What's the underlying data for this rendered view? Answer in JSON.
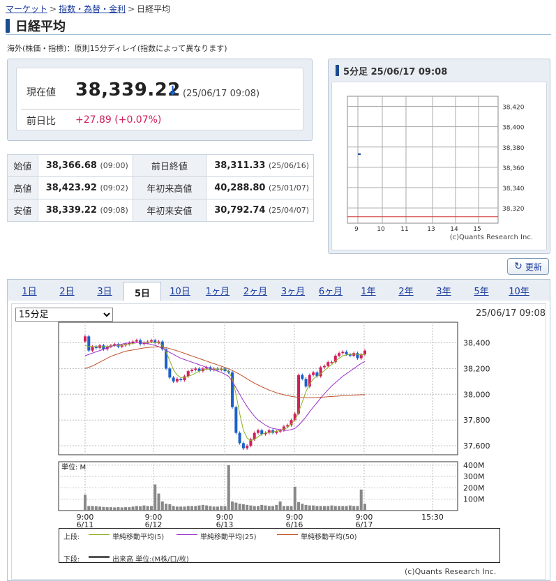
{
  "breadcrumb": {
    "items": [
      "マーケット",
      "指数・為替・金利"
    ],
    "current": "日経平均",
    "sep": ">"
  },
  "page_title": "日経平均",
  "note": "海外(株価・指標)：原則15分ディレイ(指数によって異なります)",
  "quote": {
    "label": "現在値",
    "value": "38,339.22",
    "arrow": "↓",
    "time": "(25/06/17 09:08)",
    "change_label": "前日比",
    "change": "+27.89 (+0.07%)"
  },
  "stats": [
    {
      "l1": "始値",
      "v1": "38,366.68",
      "t1": "(09:00)",
      "l2": "前日終値",
      "v2": "38,311.33",
      "t2": "(25/06/16)"
    },
    {
      "l1": "高値",
      "v1": "38,423.92",
      "t1": "(09:02)",
      "l2": "年初来高値",
      "v2": "40,288.80",
      "t2": "(25/01/07)"
    },
    {
      "l1": "安値",
      "v1": "38,339.22",
      "t1": "(09:08)",
      "l2": "年初来安値",
      "v2": "30,792.74",
      "t2": "(25/04/07)"
    }
  ],
  "mini": {
    "title": "5分足  25/06/17 09:08",
    "copyright": "(c)Quants Research Inc."
  },
  "refresh_label": "更新",
  "tabs": [
    "1日",
    "2日",
    "3日",
    "5日",
    "10日",
    "1ヶ月",
    "2ヶ月",
    "3ヶ月",
    "6ヶ月",
    "1年",
    "2年",
    "3年",
    "5年",
    "10年"
  ],
  "active_tab": "5日",
  "interval_select": {
    "value": "15分足",
    "options": [
      "15分足"
    ]
  },
  "chart_time": "25/06/17 09:08",
  "legend": {
    "upper_label": "上段:",
    "lower_label": "下段:",
    "ma5": "単純移動平均(5)",
    "ma25": "単純移動平均(25)",
    "ma50": "単純移動平均(50)",
    "volume": "出来高 単位:(M株/口/枚)"
  },
  "copyright": "(c)Quants Research Inc.",
  "colors": {
    "up": "#d0205a",
    "down": "#1b5fcc",
    "ma5": "#8ab020",
    "ma25": "#9b2fc9",
    "ma50": "#c0502a",
    "volume": "#888888",
    "accent": "#1b4c8f"
  },
  "chart_data": [
    {
      "type": "line",
      "title": "5分足 25/06/17 09:08",
      "x_ticks": [
        "9",
        "10",
        "11",
        "13",
        "14",
        "15"
      ],
      "y_ticks": [
        38320,
        38340,
        38360,
        38380,
        38400,
        38420
      ],
      "ylim": [
        38305,
        38430
      ],
      "reference_line": 38311.33,
      "series": [
        {
          "x": [
            "9:00"
          ],
          "values": [
            38373
          ]
        }
      ]
    },
    {
      "type": "candlestick",
      "title": "15分足",
      "x_ticks": [
        {
          "time": "9:00",
          "date": "6/11"
        },
        {
          "time": "9:00",
          "date": "6/12"
        },
        {
          "time": "9:00",
          "date": "6/13"
        },
        {
          "time": "9:00",
          "date": "6/16"
        },
        {
          "time": "9:00",
          "date": "6/17"
        },
        {
          "time": "15:30",
          "date": ""
        }
      ],
      "y_ticks": [
        37600,
        37800,
        38000,
        38200,
        38400
      ],
      "ylim": [
        37530,
        38560
      ],
      "volume_ticks": [
        "100M",
        "200M",
        "300M",
        "400M"
      ],
      "volume_unit": "単位: M",
      "closes": [
        38450,
        38340,
        38370,
        38360,
        38380,
        38350,
        38370,
        38380,
        38390,
        38370,
        38380,
        38390,
        38400,
        38410,
        38420,
        38390,
        38400,
        38410,
        38420,
        38400,
        38410,
        38350,
        38200,
        38130,
        38100,
        38120,
        38110,
        38140,
        38180,
        38190,
        38200,
        38180,
        38200,
        38210,
        38190,
        38200,
        38190,
        38200,
        38180,
        38170,
        37900,
        37700,
        37620,
        37580,
        37600,
        37650,
        37700,
        37720,
        37690,
        37700,
        37720,
        37700,
        37710,
        37720,
        37750,
        37760,
        37800,
        37850,
        38150,
        38120,
        38060,
        38150,
        38170,
        38140,
        38210,
        38220,
        38250,
        38250,
        38300,
        38320,
        38330,
        38310,
        38300,
        38320,
        38280,
        38310,
        38339
      ],
      "ma5": [
        38380,
        38370,
        38370,
        38370,
        38370,
        38370,
        38370,
        38375,
        38380,
        38380,
        38380,
        38385,
        38390,
        38395,
        38400,
        38400,
        38400,
        38405,
        38405,
        38405,
        38400,
        38380,
        38330,
        38260,
        38190,
        38150,
        38130,
        38130,
        38140,
        38150,
        38165,
        38180,
        38190,
        38195,
        38196,
        38196,
        38196,
        38196,
        38192,
        38180,
        38120,
        38000,
        37850,
        37720,
        37660,
        37640,
        37650,
        37670,
        37690,
        37700,
        37705,
        37708,
        37712,
        37720,
        37730,
        37740,
        37770,
        37800,
        37860,
        37940,
        38020,
        38080,
        38120,
        38140,
        38160,
        38185,
        38210,
        38230,
        38260,
        38280,
        38300,
        38305,
        38310,
        38312,
        38310,
        38305,
        38310
      ],
      "ma25": [
        38300,
        38310,
        38320,
        38330,
        38340,
        38350,
        38360,
        38370,
        38380,
        38385,
        38390,
        38395,
        38400,
        38400,
        38400,
        38400,
        38398,
        38394,
        38388,
        38380,
        38370,
        38358,
        38340,
        38325,
        38310,
        38295,
        38280,
        38270,
        38260,
        38250,
        38240,
        38230,
        38220,
        38210,
        38200,
        38190,
        38180,
        38170,
        38155,
        38140,
        38100,
        38050,
        38000,
        37950,
        37905,
        37865,
        37830,
        37800,
        37780,
        37760,
        37745,
        37735,
        37730,
        37725,
        37720,
        37720,
        37725,
        37735,
        37760,
        37790,
        37825,
        37865,
        37900,
        37935,
        37970,
        38005,
        38035,
        38065,
        38090,
        38115,
        38140,
        38160,
        38180,
        38200,
        38220,
        38240,
        38255
      ],
      "ma50": [
        38200,
        38210,
        38220,
        38235,
        38250,
        38265,
        38280,
        38295,
        38305,
        38315,
        38325,
        38335,
        38340,
        38345,
        38350,
        38355,
        38360,
        38363,
        38366,
        38368,
        38368,
        38366,
        38362,
        38355,
        38347,
        38338,
        38328,
        38318,
        38308,
        38298,
        38288,
        38278,
        38268,
        38258,
        38248,
        38238,
        38228,
        38218,
        38208,
        38198,
        38185,
        38170,
        38155,
        38138,
        38120,
        38103,
        38087,
        38072,
        38058,
        38045,
        38033,
        38022,
        38012,
        38004,
        37996,
        37990,
        37984,
        37980,
        37976,
        37974,
        37973,
        37973,
        37974,
        37975,
        37977,
        37979,
        37981,
        37983,
        37985,
        37987,
        37989,
        37991,
        37993,
        37994,
        37995,
        37996,
        37998
      ],
      "volume": [
        140,
        40,
        40,
        38,
        35,
        32,
        30,
        30,
        28,
        30,
        28,
        30,
        30,
        35,
        40,
        38,
        45,
        40,
        40,
        230,
        150,
        80,
        60,
        55,
        40,
        35,
        35,
        35,
        40,
        40,
        40,
        45,
        50,
        45,
        40,
        35,
        35,
        40,
        40,
        400,
        80,
        70,
        60,
        55,
        50,
        45,
        40,
        40,
        50,
        45,
        40,
        40,
        50,
        80,
        40,
        40,
        40,
        210,
        75,
        60,
        50,
        45,
        45,
        40,
        40,
        40,
        40,
        45,
        40,
        40,
        40,
        40,
        45,
        40,
        40,
        185,
        60
      ]
    }
  ]
}
